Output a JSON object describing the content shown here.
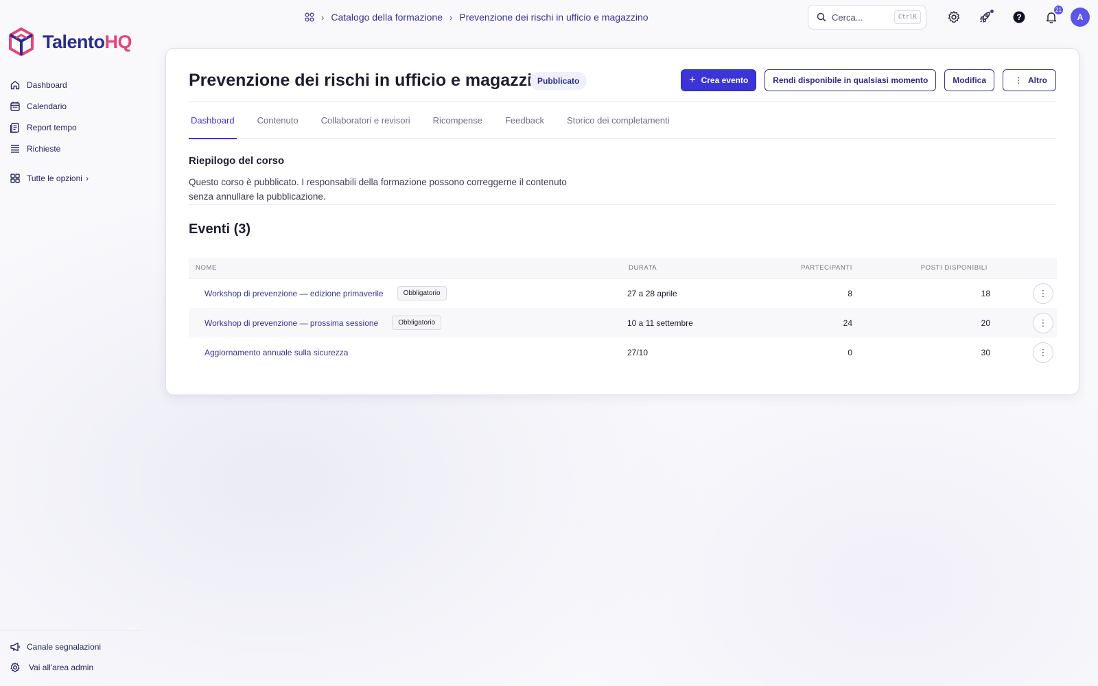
{
  "brand": {
    "name_main": "Talento",
    "name_accent": "HQ"
  },
  "sidebar": {
    "items": [
      {
        "label": "Dashboard",
        "icon": "home-icon"
      },
      {
        "label": "Calendario",
        "icon": "calendar-icon"
      },
      {
        "label": "Report tempo",
        "icon": "report-icon"
      },
      {
        "label": "Richieste",
        "icon": "list-icon"
      }
    ],
    "all_options": "Tutte le opzioni",
    "bottom": [
      {
        "label": "Canale segnalazioni",
        "icon": "megaphone-icon"
      },
      {
        "label": "Vai all'area admin",
        "icon": "gear-icon"
      }
    ]
  },
  "breadcrumb": {
    "level1": "Catalogo della formazione",
    "level2": "Prevenzione dei rischi in ufficio e magazzino"
  },
  "search": {
    "placeholder": "Cerca...",
    "shortcut": "CtrlK"
  },
  "notifications": {
    "count": "21"
  },
  "user": {
    "initial": "A"
  },
  "course": {
    "title": "Prevenzione dei rischi in ufficio e magazzino",
    "status": "Pubblicato",
    "actions": {
      "create": "Crea evento",
      "availability": "Rendi disponibile in qualsiasi momento",
      "edit": "Modifica",
      "more": "Altro"
    },
    "tabs": [
      "Dashboard",
      "Contenuto",
      "Collaboratori e revisori",
      "Ricompense",
      "Feedback",
      "Storico dei completamenti"
    ],
    "summary": {
      "title": "Riepilogo del corso",
      "text": "Questo corso è pubblicato. I responsabili della formazione possono correggerne il contenuto senza annullare la pubblicazione."
    }
  },
  "events": {
    "title": "Eventi (3)",
    "columns": {
      "name": "NOME",
      "duration": "DURATA",
      "participants": "PARTECIPANTI",
      "seats": "POSTI DISPONIBILI"
    },
    "rows": [
      {
        "name": "Workshop di prevenzione — edizione primaverile",
        "tag": "Obbligatorio",
        "duration": "27 a 28 aprile",
        "participants": "8",
        "seats": "18"
      },
      {
        "name": "Workshop di prevenzione — prossima sessione",
        "tag": "Obbligatorio",
        "duration": "10 a 11 settembre",
        "participants": "24",
        "seats": "20"
      },
      {
        "name": "Aggiornamento annuale sulla sicurezza",
        "tag": "",
        "duration": "27/10",
        "participants": "0",
        "seats": "30"
      }
    ]
  },
  "colors": {
    "accent": "#3b35d8",
    "brand_navy": "#2b2c8f",
    "brand_pink": "#e0467a"
  }
}
